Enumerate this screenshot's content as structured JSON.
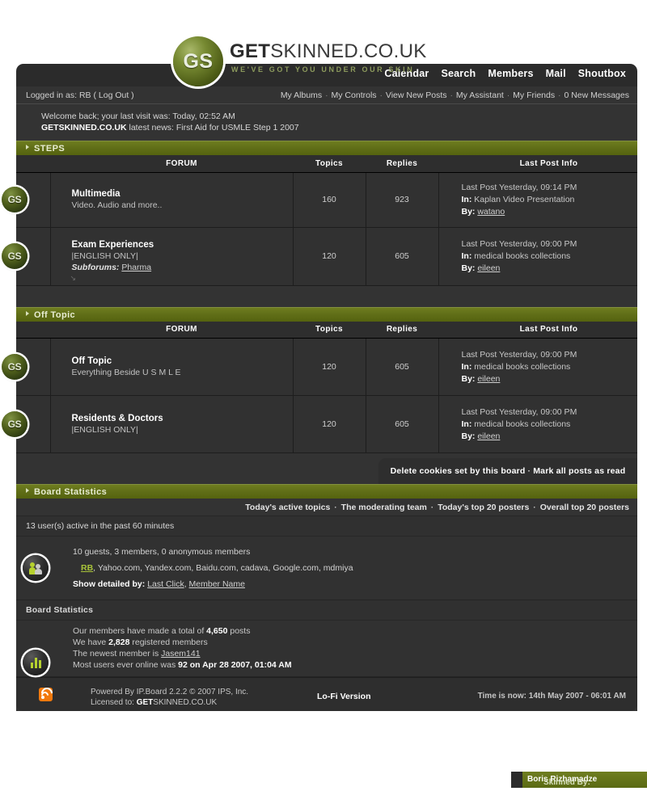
{
  "site": {
    "logo_mark": "GS",
    "logo_name_bold": "GET",
    "logo_name_rest": "SKINNED.CO.UK",
    "tagline": "WE'VE GOT YOU UNDER OUR SKIN"
  },
  "nav": {
    "items": [
      {
        "label": "Calendar"
      },
      {
        "label": "Search"
      },
      {
        "label": "Members"
      },
      {
        "label": "Mail"
      },
      {
        "label": "Shoutbox"
      }
    ]
  },
  "userbar": {
    "logged_in": "Logged in as: RB ( Log Out )",
    "links": [
      {
        "label": "My Albums"
      },
      {
        "label": "My Controls"
      },
      {
        "label": "View New Posts"
      },
      {
        "label": "My Assistant"
      },
      {
        "label": "My Friends"
      },
      {
        "label": "0 New Messages"
      }
    ]
  },
  "welcome": {
    "line1": "Welcome back; your last visit was: Today, 02:52 AM",
    "news_site": "GETSKINNED.CO.UK",
    "news_rest": " latest news: First Aid for USMLE Step 1 2007"
  },
  "table_headers": {
    "forum": "FORUM",
    "topics": "Topics",
    "replies": "Replies",
    "last_post": "Last Post Info"
  },
  "categories": [
    {
      "title": "STEPS",
      "forums": [
        {
          "icon": "GS",
          "name": "Multimedia",
          "desc": "Video. Audio and more..",
          "subforums_label": "",
          "subforums": [],
          "topics": "160",
          "replies": "923",
          "last_post_time": "Last Post Yesterday, 09:14 PM",
          "in_label": "In:",
          "in_topic": " Kaplan Video Presentation",
          "by_label": "By:",
          "by_user": "watano",
          "has_resize_glyph": false
        },
        {
          "icon": "GS",
          "name": "Exam Experiences",
          "desc": "|ENGLISH ONLY|",
          "subforums_label": "Subforums:",
          "subforums": [
            "Pharma"
          ],
          "topics": "120",
          "replies": "605",
          "last_post_time": "Last Post Yesterday, 09:00 PM",
          "in_label": "In:",
          "in_topic": " medical books collections",
          "by_label": "By:",
          "by_user": "eileen",
          "has_resize_glyph": true
        }
      ]
    },
    {
      "title": "Off Topic",
      "forums": [
        {
          "icon": "GS",
          "name": "Off Topic",
          "desc": "Everything Beside U S M L E",
          "subforums_label": "",
          "subforums": [],
          "topics": "120",
          "replies": "605",
          "last_post_time": "Last Post Yesterday, 09:00 PM",
          "in_label": "In:",
          "in_topic": " medical books collections",
          "by_label": "By:",
          "by_user": "eileen",
          "has_resize_glyph": false
        },
        {
          "icon": "GS",
          "name": "Residents & Doctors",
          "desc": "|ENGLISH ONLY|",
          "subforums_label": "",
          "subforums": [],
          "topics": "120",
          "replies": "605",
          "last_post_time": "Last Post Yesterday, 09:00 PM",
          "in_label": "In:",
          "in_topic": " medical books collections",
          "by_label": "By:",
          "by_user": "eileen",
          "has_resize_glyph": false
        }
      ]
    }
  ],
  "tools": {
    "delete_cookies": "Delete cookies set by this board",
    "mark_read": "Mark all posts as read"
  },
  "board_stats": {
    "title": "Board Statistics",
    "links": [
      {
        "label": "Today's active topics"
      },
      {
        "label": "The moderating team"
      },
      {
        "label": "Today's top 20 posters"
      },
      {
        "label": "Overall top 20 posters"
      }
    ],
    "active_head": "13 user(s) active in the past 60 minutes",
    "breakdown": "10 guests, 3 members, 0 anonymous members",
    "me_user": "RB",
    "other_users": ", Yahoo.com, Yandex.com, Baidu.com, cadava, Google.com, mdmiya",
    "show_detailed_label": "Show detailed by:",
    "detail_links": [
      "Last Click",
      "Member Name"
    ],
    "section_label": "Board Statistics",
    "stat_posts_pre": "Our members have made a total of ",
    "stat_posts_num": "4,650",
    "stat_posts_post": " posts",
    "stat_members_pre": "We have ",
    "stat_members_num": "2,828",
    "stat_members_post": " registered members",
    "stat_newest_pre": "The newest member is ",
    "stat_newest_name": "Jasem141",
    "stat_online_pre": "Most users ever online was ",
    "stat_online_num": "92",
    "stat_online_post": " on Apr 28 2007, 01:04 AM"
  },
  "footer": {
    "powered_by": "Powered By IP.Board  2.2.2 © 2007  IPS, Inc.",
    "licensed_pre": "Licensed to: ",
    "licensed_bold": "GET",
    "licensed_rest": "SKINNED.CO.UK",
    "lofi": "Lo-Fi Version",
    "time_now": "Time is now: 14th May 2007 - 06:01 AM",
    "rss_icon": "rss-icon"
  },
  "skinned_by": {
    "prefix": "Skinned By: ",
    "author": "Boris Rizhamadze"
  },
  "colors": {
    "accent_green": "#616f18",
    "panel_dark": "#313131",
    "bar_dark": "#2e2e2e",
    "link_green": "#a9c43a",
    "rss_orange": "#f2790d"
  }
}
